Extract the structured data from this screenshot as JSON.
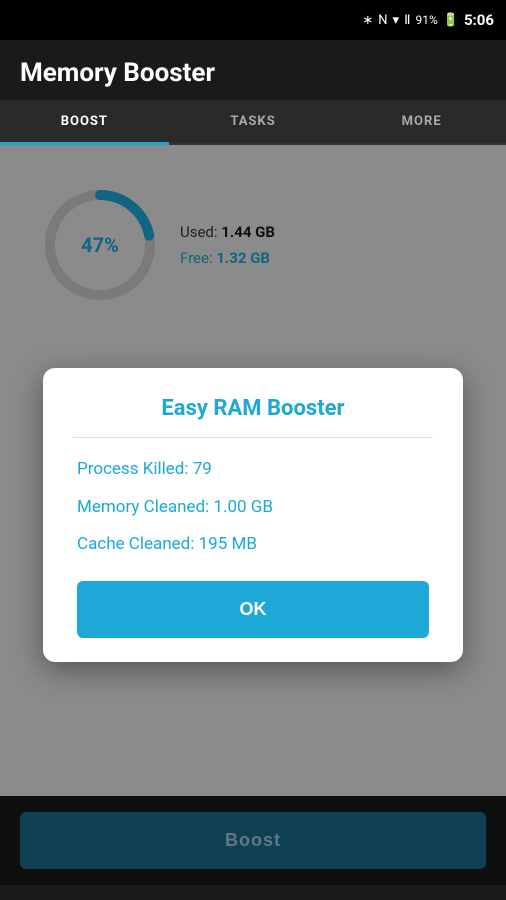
{
  "statusBar": {
    "battery": "91%",
    "time": "5:06"
  },
  "header": {
    "title": "Memory Booster"
  },
  "tabs": [
    {
      "id": "boost",
      "label": "BOOST",
      "active": true
    },
    {
      "id": "tasks",
      "label": "TASKS",
      "active": false
    },
    {
      "id": "more",
      "label": "MORE",
      "active": false
    }
  ],
  "memoryDisplay": {
    "percent": "47%",
    "usedLabel": "Used: ",
    "usedValue": "1.44 GB",
    "freeLabel": "Free:  ",
    "freeValue": "1.32 GB"
  },
  "boostButton": {
    "label": "Boost"
  },
  "dialog": {
    "title": "Easy RAM Booster",
    "processKilledLabel": "Process Killed: ",
    "processKilledValue": "79",
    "memoryCleanedLabel": "Memory Cleaned: ",
    "memoryCleanedValue": "1.00 GB",
    "cacheCleanedLabel": "Cache Cleaned: ",
    "cacheCleanedValue": "195 MB",
    "okButton": "OK"
  }
}
